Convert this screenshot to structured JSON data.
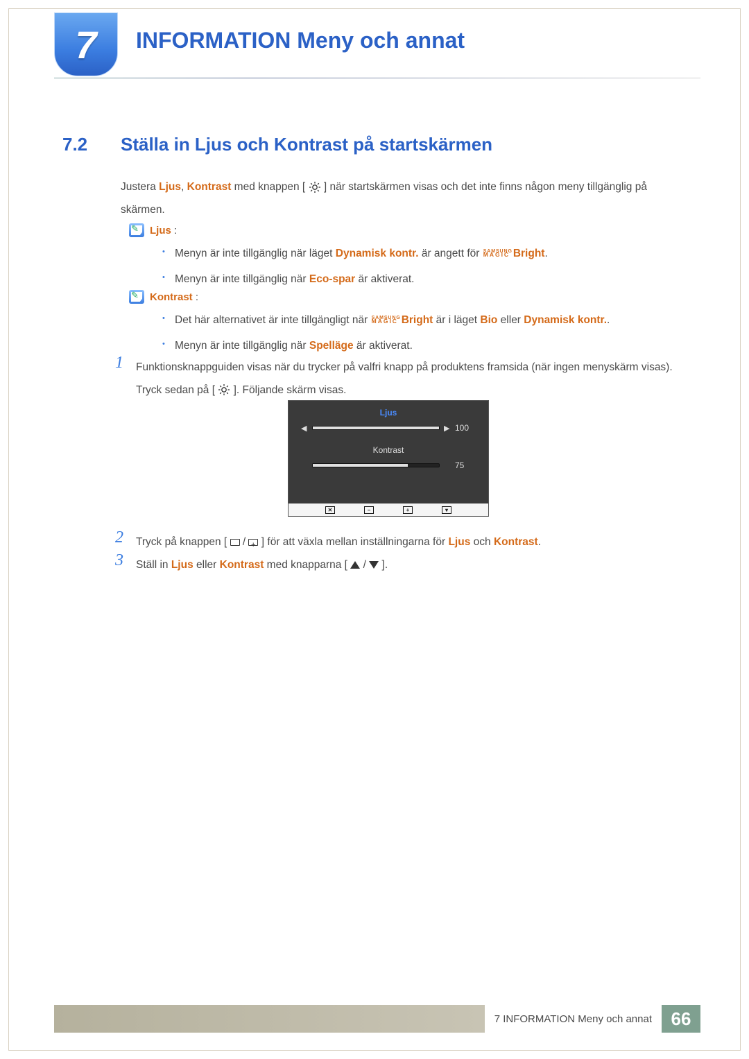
{
  "chapter": {
    "number": "7",
    "title": "INFORMATION Meny och annat"
  },
  "section": {
    "number": "7.2",
    "title": "Ställa in Ljus och Kontrast på startskärmen"
  },
  "intro": {
    "pre": "Justera ",
    "ljus": "Ljus",
    "sep": ", ",
    "kontrast": "Kontrast",
    "mid": " med knappen [ ",
    "post": " ] när startskärmen visas och det inte finns någon meny tillgänglig på skärmen."
  },
  "noteLjus": {
    "label": "Ljus "
  },
  "ljusBullets": {
    "b1_pre": "Menyn är inte tillgänglig när läget ",
    "b1_hl": "Dynamisk kontr.",
    "b1_mid": " är angett för ",
    "b1_post": "Bright",
    "b1_end": ".",
    "b2_pre": "Menyn är inte tillgänglig när ",
    "b2_hl": "Eco-spar",
    "b2_post": " är aktiverat."
  },
  "noteKontrast": {
    "label": "Kontrast "
  },
  "kontrastBullets": {
    "b1_pre": "Det här alternativet är inte tillgängligt när ",
    "b1_post": "Bright",
    "b1_mid2": " är i läget ",
    "b1_bio": "Bio",
    "b1_or": " eller ",
    "b1_dk": "Dynamisk kontr.",
    "b1_end": ".",
    "b2_pre": "Menyn är inte tillgänglig när ",
    "b2_hl": "Spelläge",
    "b2_post": " är aktiverat."
  },
  "magic": {
    "samsung": "SAMSUNG",
    "magic": "MAGIC"
  },
  "steps": {
    "s1_num": "1",
    "s1_a": "Funktionsknappguiden visas när du trycker på valfri knapp på produktens framsida (när ingen menyskärm visas). Tryck sedan på [ ",
    "s1_b": " ]. Följande skärm visas.",
    "s2_num": "2",
    "s2_a": "Tryck på knappen [ ",
    "s2_slash": " / ",
    "s2_b": " ] för att växla mellan inställningarna för ",
    "s2_ljus": "Ljus",
    "s2_och": " och ",
    "s2_kontrast": "Kontrast",
    "s2_end": ".",
    "s3_num": "3",
    "s3_a": "Ställ in ",
    "s3_ljus": "Ljus",
    "s3_eller": " eller ",
    "s3_kontrast": "Kontrast",
    "s3_b": " med knapparna [ ",
    "s3_slash": " / ",
    "s3_c": " ]."
  },
  "osd": {
    "ljusLabel": "Ljus",
    "ljusValue": "100",
    "kontrastLabel": "Kontrast",
    "kontrastValue": "75",
    "ljusFillPct": 100,
    "kontrastFillPct": 75
  },
  "footer": {
    "chapterRef": "7 INFORMATION Meny och annat",
    "pageNum": "66"
  },
  "colon": " :"
}
